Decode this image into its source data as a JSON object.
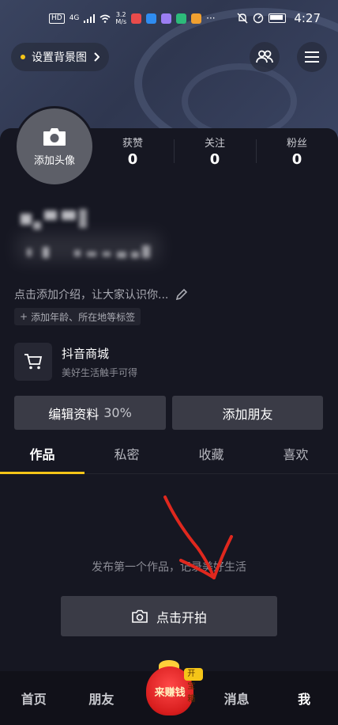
{
  "status_bar": {
    "hd": "HD",
    "signal": "4G",
    "speed_value": "3.2",
    "speed_unit": "M/s",
    "more": "···",
    "time": "4:27",
    "app_icon_colors": [
      "#e84b4b",
      "#2f8cf0",
      "#9b7ef2",
      "#2dbb7a",
      "#f0a030"
    ]
  },
  "header": {
    "set_background_label": "设置背景图",
    "friends_icon": "friends-icon",
    "menu_icon": "menu-icon"
  },
  "profile": {
    "avatar_label": "添加头像",
    "stats": [
      {
        "label": "获赞",
        "value": "0"
      },
      {
        "label": "关注",
        "value": "0"
      },
      {
        "label": "粉丝",
        "value": "0"
      }
    ],
    "bio_placeholder": "点击添加介绍，让大家认识你...",
    "tag_label": "添加年龄、所在地等标签",
    "shop_title": "抖音商城",
    "shop_subtitle": "美好生活触手可得",
    "edit_profile_label": "编辑资料",
    "edit_profile_percent": "30%",
    "add_friend_label": "添加朋友"
  },
  "tabs": [
    {
      "label": "作品",
      "active": true
    },
    {
      "label": "私密",
      "active": false
    },
    {
      "label": "收藏",
      "active": false
    },
    {
      "label": "喜欢",
      "active": false
    }
  ],
  "empty_state": {
    "message": "发布第一个作品，记录美好生活",
    "button_label": "点击开拍"
  },
  "bottom_nav": {
    "home": "首页",
    "friends": "朋友",
    "earn": "来赚钱",
    "treasure_badge": "开宝箱",
    "messages": "消息",
    "me": "我"
  },
  "colors": {
    "accent": "#f5c518",
    "background": "#161722",
    "button": "#3a3b46",
    "annotation_arrow": "#e0281e"
  }
}
